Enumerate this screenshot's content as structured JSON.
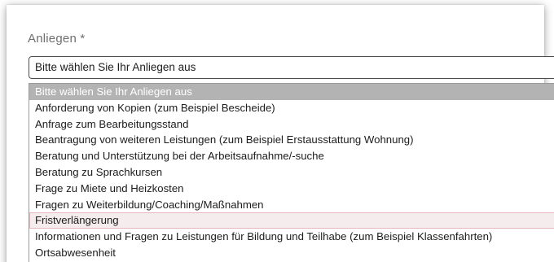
{
  "field": {
    "label": "Anliegen *",
    "selected_value": "Bitte wählen Sie Ihr Anliegen aus"
  },
  "dropdown": {
    "options": [
      {
        "label": "Bitte wählen Sie Ihr Anliegen aus",
        "state": "selected"
      },
      {
        "label": "Anforderung von Kopien (zum Beispiel Bescheide)",
        "state": "normal"
      },
      {
        "label": "Anfrage zum Bearbeitungsstand",
        "state": "normal"
      },
      {
        "label": "Beantragung von weiteren Leistungen (zum Beispiel Erstausstattung Wohnung)",
        "state": "normal"
      },
      {
        "label": "Beratung und Unterstützung bei der Arbeitsaufnahme/-suche",
        "state": "normal"
      },
      {
        "label": "Beratung zu Sprachkursen",
        "state": "normal"
      },
      {
        "label": "Frage zu Miete und Heizkosten",
        "state": "normal"
      },
      {
        "label": "Fragen zu Weiterbildung/Coaching/Maßnahmen",
        "state": "normal"
      },
      {
        "label": "Fristverlängerung",
        "state": "hovered"
      },
      {
        "label": "Informationen und Fragen zu Leistungen für Bildung und Teilhabe (zum Beispiel Klassenfahrten)",
        "state": "normal"
      },
      {
        "label": "Ortsabwesenheit",
        "state": "normal"
      }
    ]
  }
}
